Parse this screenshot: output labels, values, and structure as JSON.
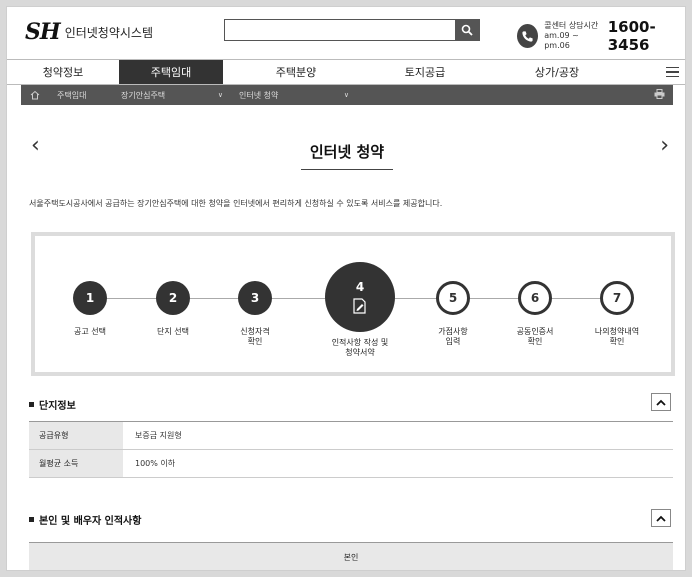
{
  "header": {
    "logo_mark": "SH",
    "logo_text": "인터넷청약시스템",
    "search": {
      "value": "",
      "placeholder": ""
    },
    "callcenter": {
      "label": "콜센터 상담시간",
      "hours": "am.09 ~ pm.06",
      "number": "1600-3456"
    }
  },
  "nav": {
    "items": [
      {
        "label": "청약정보"
      },
      {
        "label": "주택임대"
      },
      {
        "label": "주택분양"
      },
      {
        "label": "토지공급"
      },
      {
        "label": "상가/공장"
      }
    ],
    "active_index": 1
  },
  "breadcrumb": {
    "items": [
      "주택임대",
      "장기안심주택",
      "인터넷 청약"
    ]
  },
  "page": {
    "title": "인터넷 청약",
    "description": "서울주택도시공사에서 공급하는 장기안심주택에 대한 청약을 인터넷에서 편리하게 신청하실 수 있도록 서비스를 제공합니다."
  },
  "steps": [
    {
      "num": "1",
      "label": "공고 선택",
      "state": "done"
    },
    {
      "num": "2",
      "label": "단지 선택",
      "state": "done"
    },
    {
      "num": "3",
      "label": "신청자격\n확인",
      "state": "done"
    },
    {
      "num": "4",
      "label": "인적사항 작성 및\n청약서약",
      "state": "current"
    },
    {
      "num": "5",
      "label": "가점사항\n입력",
      "state": "todo"
    },
    {
      "num": "6",
      "label": "공동인증서\n확인",
      "state": "todo"
    },
    {
      "num": "7",
      "label": "나의청약내역\n확인",
      "state": "todo"
    }
  ],
  "complex_info": {
    "title": "단지정보",
    "rows": [
      {
        "label": "공급유형",
        "value": "보증금 지원형"
      },
      {
        "label": "월평균 소득",
        "value": "100% 이하"
      }
    ]
  },
  "personal_info": {
    "title": "본인 및 배우자 인적사항",
    "column_header": "본인"
  },
  "colors": {
    "dark": "#333333",
    "bar": "#555555",
    "label_bg": "#e8e8e8"
  }
}
